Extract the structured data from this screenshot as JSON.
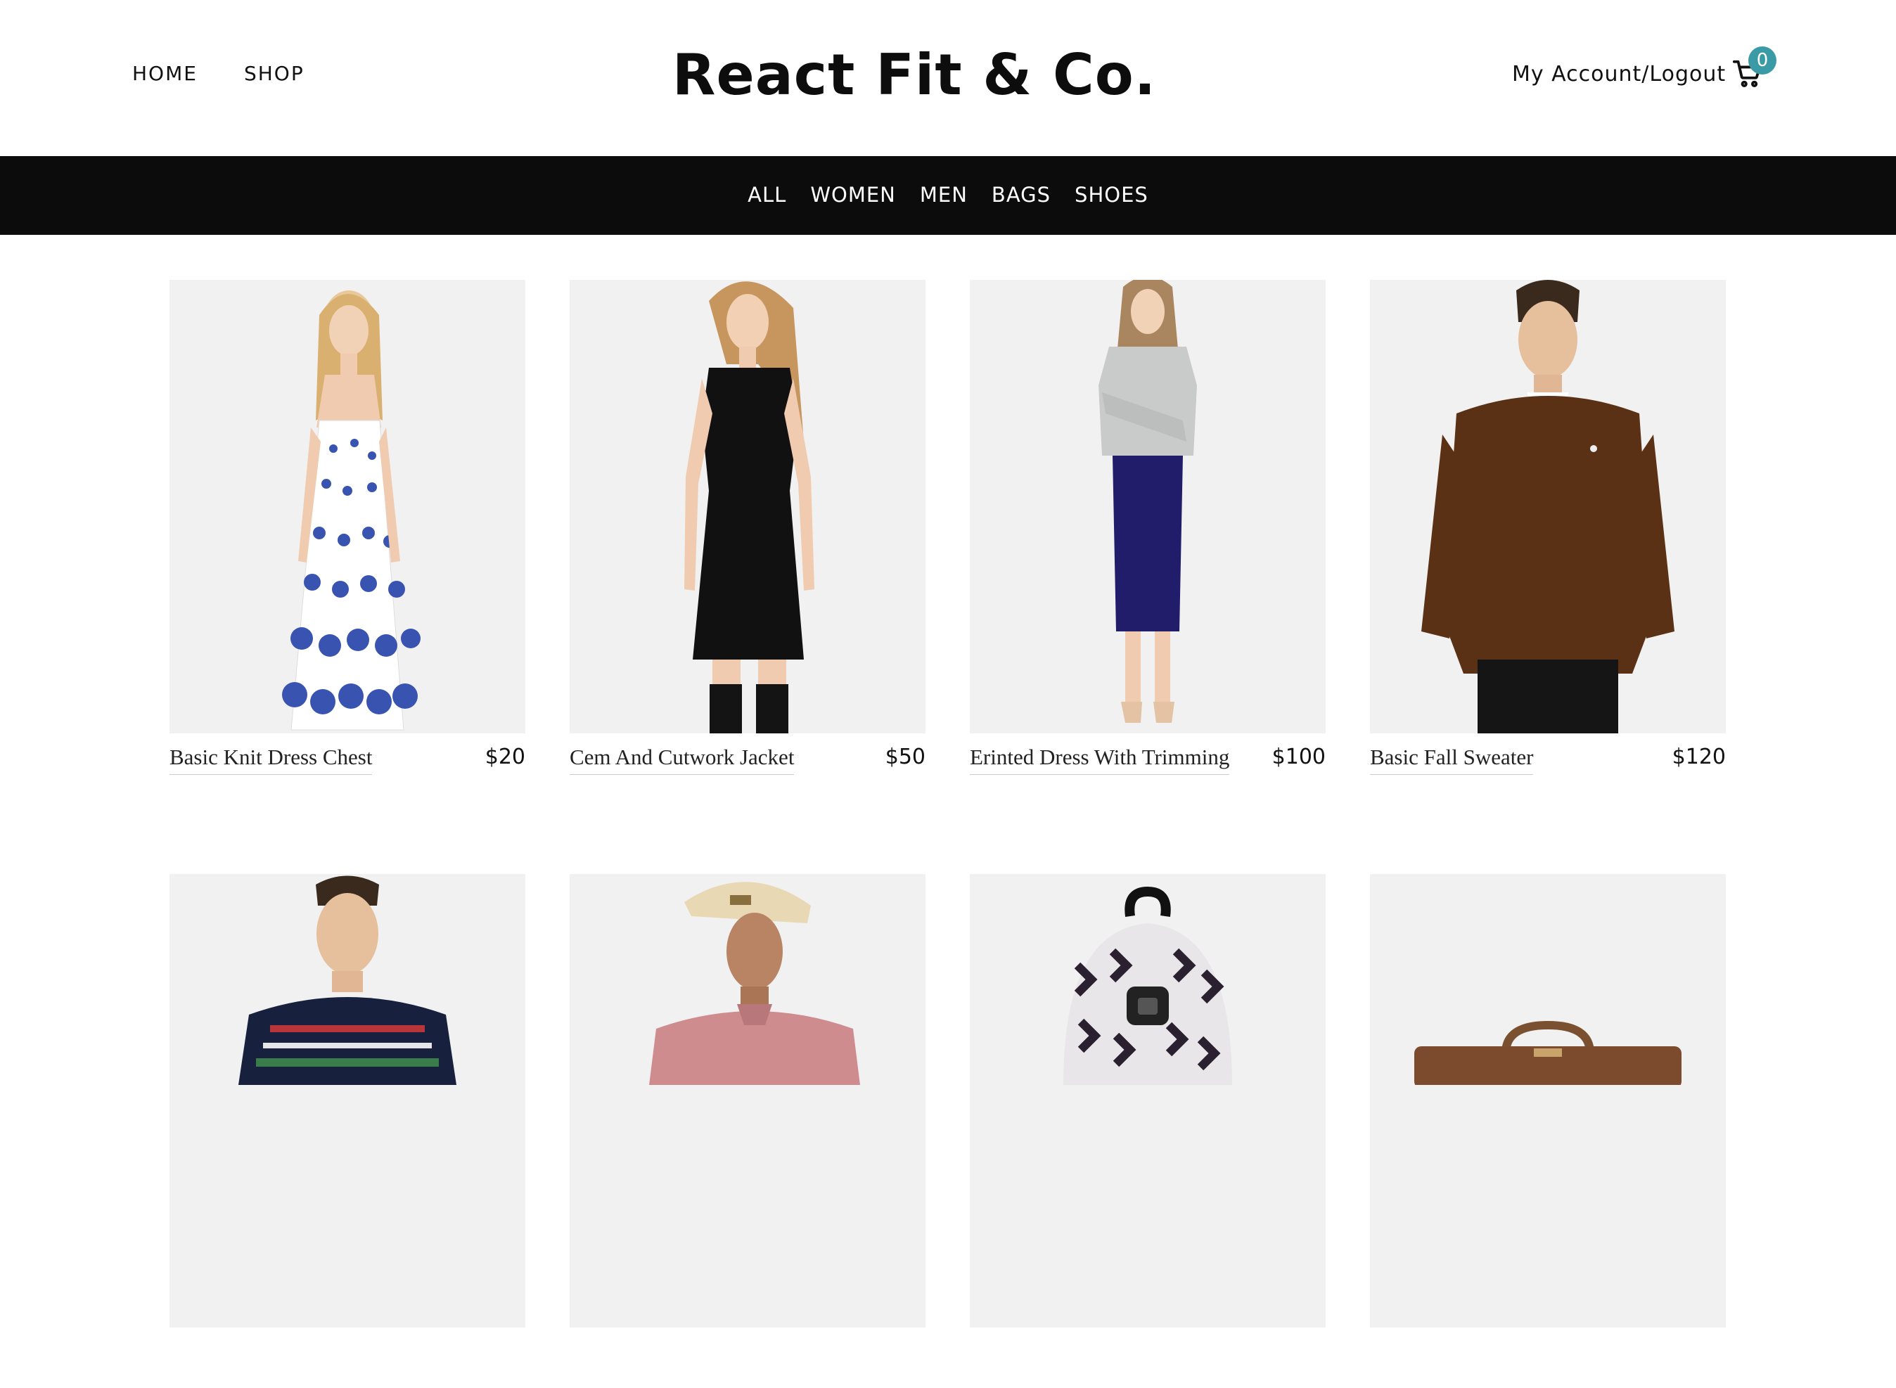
{
  "header": {
    "nav": [
      "HOME",
      "SHOP"
    ],
    "brand": "React Fit & Co.",
    "account_link": "My Account/Logout",
    "cart_count": "0",
    "cart_icon": "cart-icon",
    "badge_color": "#3a9aa6"
  },
  "categories": [
    "ALL",
    "WOMEN",
    "MEN",
    "BAGS",
    "SHOES"
  ],
  "products": [
    {
      "name": "Basic Knit Dress Chest",
      "price": "$20",
      "image": "woman-floral-dress"
    },
    {
      "name": "Cem And Cutwork Jacket",
      "price": "$50",
      "image": "woman-black-dress"
    },
    {
      "name": "Erinted Dress With Trimming",
      "price": "$100",
      "image": "woman-grey-sweater-navy-skirt"
    },
    {
      "name": "Basic Fall Sweater",
      "price": "$120",
      "image": "man-brown-sweater"
    },
    {
      "name": "",
      "price": "",
      "image": "man-fair-isle-sweater"
    },
    {
      "name": "",
      "price": "",
      "image": "man-cap-pink-polo"
    },
    {
      "name": "",
      "price": "",
      "image": "patterned-backpack"
    },
    {
      "name": "",
      "price": "",
      "image": "brown-leather-bag"
    }
  ]
}
